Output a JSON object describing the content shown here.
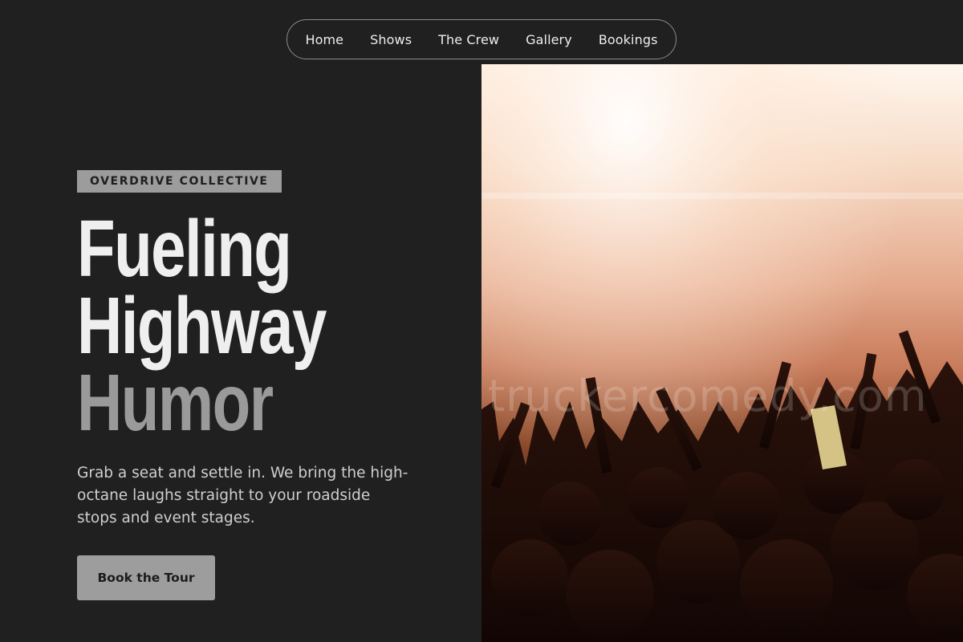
{
  "nav": {
    "items": [
      {
        "label": "Home"
      },
      {
        "label": "Shows"
      },
      {
        "label": "The Crew"
      },
      {
        "label": "Gallery"
      },
      {
        "label": "Bookings"
      }
    ]
  },
  "hero": {
    "tag": "OVERDRIVE COLLECTIVE",
    "headline": [
      "Fueling",
      "Highway",
      "Humor"
    ],
    "lead": "Grab a seat and settle in. We bring the high-octane laughs straight to your roadside stops and event stages.",
    "cta_label": "Book the Tour"
  },
  "photo": {
    "watermark": "truckercomedy.com",
    "alt": "concert-crowd-photo"
  },
  "colors": {
    "background": "#202020",
    "accent_gray": "#9c9c9c",
    "headline_light": "#efefef",
    "headline_dim": "#9a9a9a"
  }
}
